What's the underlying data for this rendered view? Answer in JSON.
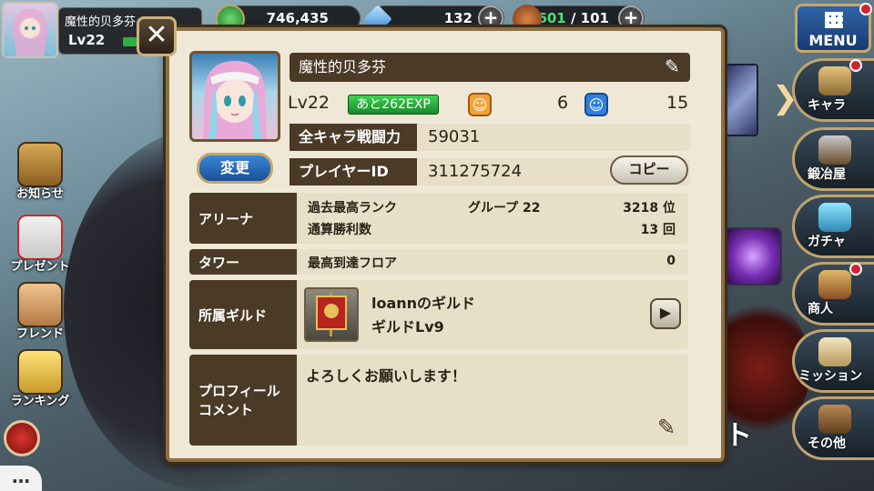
{
  "hud": {
    "player_name": "魔性的贝多芬",
    "player_level": "Lv22",
    "gold": "746,435",
    "gems": "132",
    "stamina": "601",
    "stamina_max": "/ 101",
    "menu_label": "MENU"
  },
  "left_nav": [
    {
      "label": "お知らせ",
      "icon": "notice-board-icon"
    },
    {
      "label": "プレゼント",
      "icon": "gift-box-icon"
    },
    {
      "label": "フレンド",
      "icon": "handshake-icon"
    },
    {
      "label": "ランキング",
      "icon": "crown-icon"
    }
  ],
  "right_nav": [
    {
      "label": "キャラ",
      "icon": "character-icon",
      "badge": true
    },
    {
      "label": "鍛冶屋",
      "icon": "anvil-icon",
      "badge": false
    },
    {
      "label": "ガチャ",
      "icon": "gacha-icon",
      "badge": false
    },
    {
      "label": "商人",
      "icon": "shop-icon",
      "badge": true
    },
    {
      "label": "ミッション",
      "icon": "scroll-icon",
      "badge": false
    },
    {
      "label": "その他",
      "icon": "door-icon",
      "badge": false
    }
  ],
  "bg_partial_text": "ト",
  "chat_label": "…",
  "profile": {
    "name": "魔性的贝多芬",
    "level": "Lv22",
    "exp_to_next": "あと262EXP",
    "stat1_value": "6",
    "stat2_value": "15",
    "change_label": "変更",
    "power_label": "全キャラ戦闘力",
    "power_value": "59031",
    "player_id_label": "プレイヤーID",
    "player_id_value": "311275724",
    "copy_label": "コピー",
    "arena_label": "アリーナ",
    "arena_best_rank_label": "過去最高ランク",
    "arena_group_label": "グループ 22",
    "arena_rank_value": "3218 位",
    "arena_wins_label": "通算勝利数",
    "arena_wins_value": "13 回",
    "tower_label": "タワー",
    "tower_floor_label": "最高到達フロア",
    "tower_floor_value": "0",
    "guild_label": "所属ギルド",
    "guild_name": "loannのギルド",
    "guild_level": "ギルドLv9",
    "comment_label_line1": "プロフィール",
    "comment_label_line2": "コメント",
    "comment_text": "よろしくお願いします！"
  },
  "colors": {
    "panel": "#efe8d6",
    "label_brown": "#4a3a26",
    "exp_green": "#2bb13f",
    "blue_button": "#2a6dc0",
    "badge_red": "#d6222c"
  }
}
